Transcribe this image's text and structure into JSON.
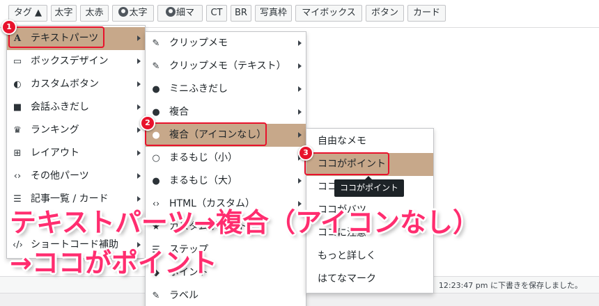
{
  "toolbar": {
    "buttons": [
      {
        "label": "タグ ▲"
      },
      {
        "label": "太字"
      },
      {
        "label": "太赤"
      },
      {
        "label": "太字"
      },
      {
        "label": "細マ"
      },
      {
        "label": "CT"
      },
      {
        "label": "BR"
      },
      {
        "label": "写真枠"
      },
      {
        "label": "マイボックス"
      },
      {
        "label": "ボタン"
      },
      {
        "label": "カード"
      }
    ]
  },
  "menu1": {
    "items": [
      {
        "label": "テキストパーツ",
        "icon": "text-a-icon"
      },
      {
        "label": "ボックスデザイン",
        "icon": "inbox-icon"
      },
      {
        "label": "カスタムボタン",
        "icon": "toggle-icon"
      },
      {
        "label": "会話ふきだし",
        "icon": "speech-bubbles-icon"
      },
      {
        "label": "ランキング",
        "icon": "crown-icon"
      },
      {
        "label": "レイアウト",
        "icon": "grid-icon"
      },
      {
        "label": "その他パーツ",
        "icon": "code-brackets-icon"
      },
      {
        "label": "記事一覧 / カード",
        "icon": "list-icon"
      },
      {
        "label": "ショートコード補助",
        "icon": "code-slash-icon"
      }
    ]
  },
  "menu2": {
    "items": [
      {
        "label": "クリップメモ",
        "icon": "paperclip-icon"
      },
      {
        "label": "クリップメモ（テキスト）",
        "icon": "paperclip-icon"
      },
      {
        "label": "ミニふきだし",
        "icon": "comment-dots-icon"
      },
      {
        "label": "複合",
        "icon": "bomb-icon"
      },
      {
        "label": "複合（アイコンなし）",
        "icon": "bomb-icon"
      },
      {
        "label": "まるもじ（小）",
        "icon": "circle-outline-icon"
      },
      {
        "label": "まるもじ（大）",
        "icon": "circle-filled-icon"
      },
      {
        "label": "HTML（カスタム）",
        "icon": "code-icon"
      },
      {
        "label": "カスタムポイント",
        "icon": "star-icon"
      },
      {
        "label": "ステップ",
        "icon": "steps-icon"
      },
      {
        "label": "ポイント",
        "icon": "pin-icon"
      },
      {
        "label": "ラベル",
        "icon": "pencil-icon"
      }
    ]
  },
  "menu3": {
    "items": [
      {
        "label": "自由なメモ"
      },
      {
        "label": "ココがポイント"
      },
      {
        "label": "ココがダメ"
      },
      {
        "label": "ココがバツ"
      },
      {
        "label": "ココに注意"
      },
      {
        "label": "もっと詳しく"
      },
      {
        "label": "はてなマーク"
      }
    ]
  },
  "tooltip": "ココがポイント",
  "badges": [
    "1",
    "2",
    "3"
  ],
  "status": "12:23:47 pm に下書きを保存しました。",
  "annotation": {
    "line1": "テキストパーツ→複合（アイコンなし）",
    "line2": "→ココがポイント"
  },
  "colors": {
    "active_row": "#c7a88a",
    "highlight": "#e8122c",
    "overlay_text": "#ff2d6f"
  }
}
